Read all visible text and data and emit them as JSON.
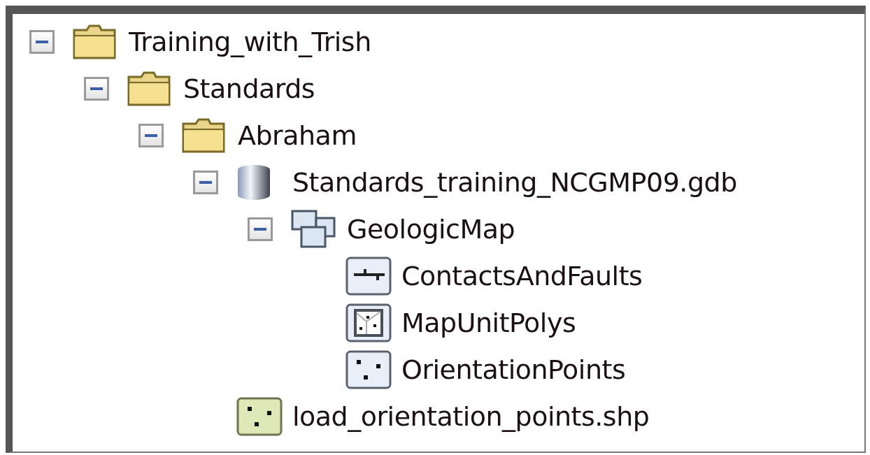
{
  "tree": [
    {
      "label": "Training_with_Trish",
      "kind": "folder",
      "expanded": true,
      "children": [
        {
          "label": "Standards",
          "kind": "folder",
          "expanded": true,
          "children": [
            {
              "label": "Abraham",
              "kind": "folder",
              "expanded": true,
              "children": [
                {
                  "label": "Standards_training_NCGMP09.gdb",
                  "kind": "geodatabase",
                  "expanded": true,
                  "children": [
                    {
                      "label": "GeologicMap",
                      "kind": "dataset",
                      "expanded": true,
                      "children": [
                        {
                          "label": "ContactsAndFaults",
                          "kind": "line"
                        },
                        {
                          "label": "MapUnitPolys",
                          "kind": "polygon"
                        },
                        {
                          "label": "OrientationPoints",
                          "kind": "point"
                        }
                      ]
                    }
                  ]
                },
                {
                  "label": "load_orientation_points.shp",
                  "kind": "shapefile"
                }
              ]
            }
          ]
        }
      ]
    }
  ]
}
